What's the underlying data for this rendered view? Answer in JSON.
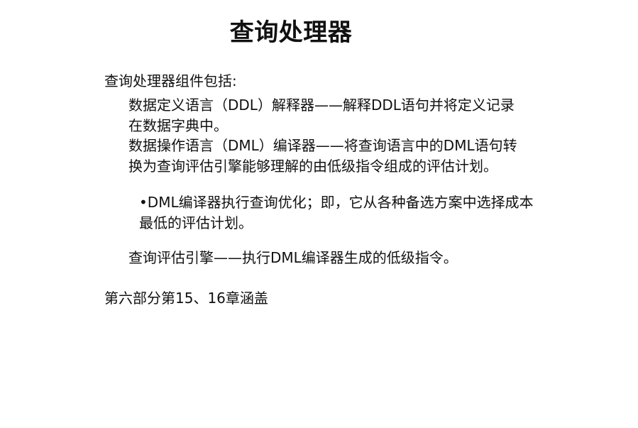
{
  "slide": {
    "title": "查询处理器",
    "intro": "查询处理器组件包括:",
    "components": [
      {
        "line1": "数据定义语言（DDL）解释器——解释DDL语句并将定义记录",
        "line2": "在数据字典中。"
      },
      {
        "line1": "数据操作语言（DML）编译器——将查询语言中的DML语句转",
        "line2": "换为查询评估引擎能够理解的由低级指令组成的评估计划。"
      }
    ],
    "sub_bullet": {
      "line1": "•DML编译器执行查询优化；即，它从各种备选方案中选择成本",
      "line2": "最低的评估计划。"
    },
    "eval_engine": "查询评估引擎——执行DML编译器生成的低级指令。",
    "footer": "第六部分第15、16章涵盖"
  }
}
